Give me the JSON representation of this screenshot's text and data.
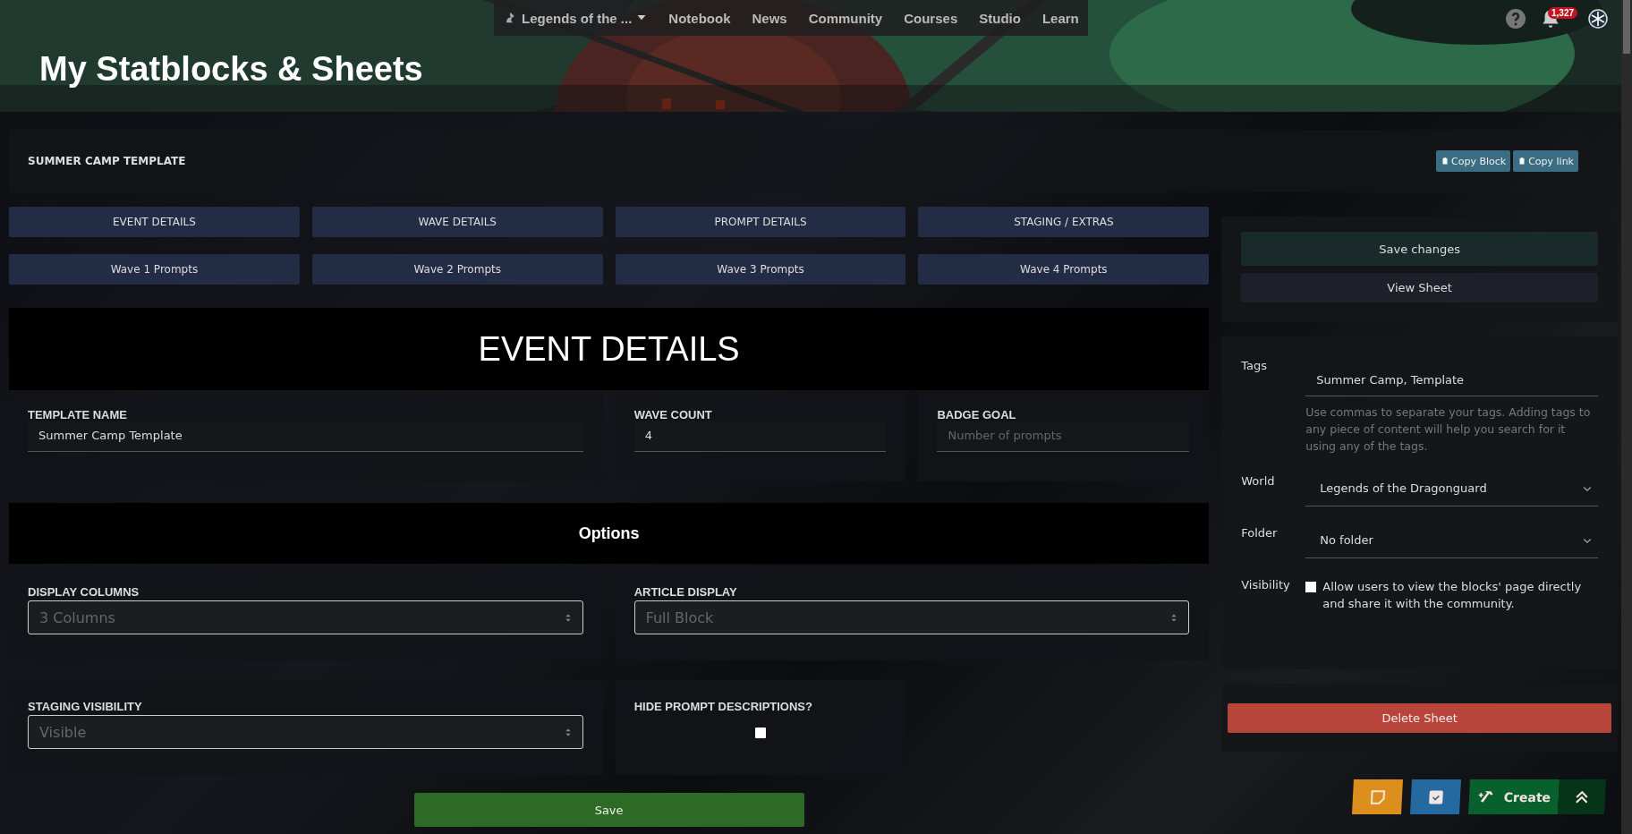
{
  "nav": {
    "world": "Legends of the ...",
    "links": [
      "Notebook",
      "News",
      "Community",
      "Courses",
      "Studio",
      "Learn"
    ],
    "notification_count": "1,327"
  },
  "header": {
    "title": "My Statblocks & Sheets"
  },
  "sheet_title": "SUMMER CAMP TEMPLATE",
  "copy_buttons": [
    "Copy Block",
    "Copy link"
  ],
  "section_tabs": [
    "EVENT DETAILS",
    "WAVE DETAILS",
    "PROMPT DETAILS",
    "STAGING / EXTRAS",
    "Wave 1 Prompts",
    "Wave 2 Prompts",
    "Wave 3 Prompts",
    "Wave 4 Prompts"
  ],
  "section_heading": "EVENT DETAILS",
  "fields": [
    {
      "label": "TEMPLATE NAME",
      "kind": "wide",
      "value": "Summer Camp Template"
    },
    {
      "label": "WAVE COUNT",
      "kind": "narrow",
      "value": "4"
    },
    {
      "label": "BADGE GOAL",
      "kind": "narrow",
      "placeholder": "Number of prompts"
    }
  ],
  "options_heading": "Options",
  "options": [
    {
      "label": "DISPLAY COLUMNS",
      "kind": "select",
      "value": "3 Columns"
    },
    {
      "label": "ARTICLE DISPLAY",
      "kind": "select",
      "value": "Full Block"
    },
    {
      "label": "STAGING VISIBILITY",
      "kind": "select",
      "value": "Visible"
    },
    {
      "label": "HIDE PROMPT DESCRIPTIONS?",
      "kind": "checkbox",
      "checked": false
    }
  ],
  "save_button": "Save",
  "sidebar": {
    "actions": [
      {
        "label": "Save changes",
        "kind": "primary"
      },
      {
        "label": "View Sheet",
        "kind": "secondary"
      }
    ],
    "tags": {
      "label": "Tags",
      "value": "Summer Camp, Template",
      "help": "Use commas to separate your tags. Adding tags to any piece of content will help you search for it using any of the tags."
    },
    "world": {
      "label": "World",
      "value": "Legends of the Dragonguard"
    },
    "folder": {
      "label": "Folder",
      "value": "No folder"
    },
    "visibility": {
      "label": "Visibility",
      "text": "Allow users to view the blocks' page directly and share it with the community.",
      "checked": false
    },
    "delete_button": "Delete Sheet"
  },
  "floating_buttons": [
    {
      "kind": "note"
    },
    {
      "kind": "tasks"
    },
    {
      "kind": "create",
      "label": "Create"
    },
    {
      "kind": "top"
    }
  ]
}
